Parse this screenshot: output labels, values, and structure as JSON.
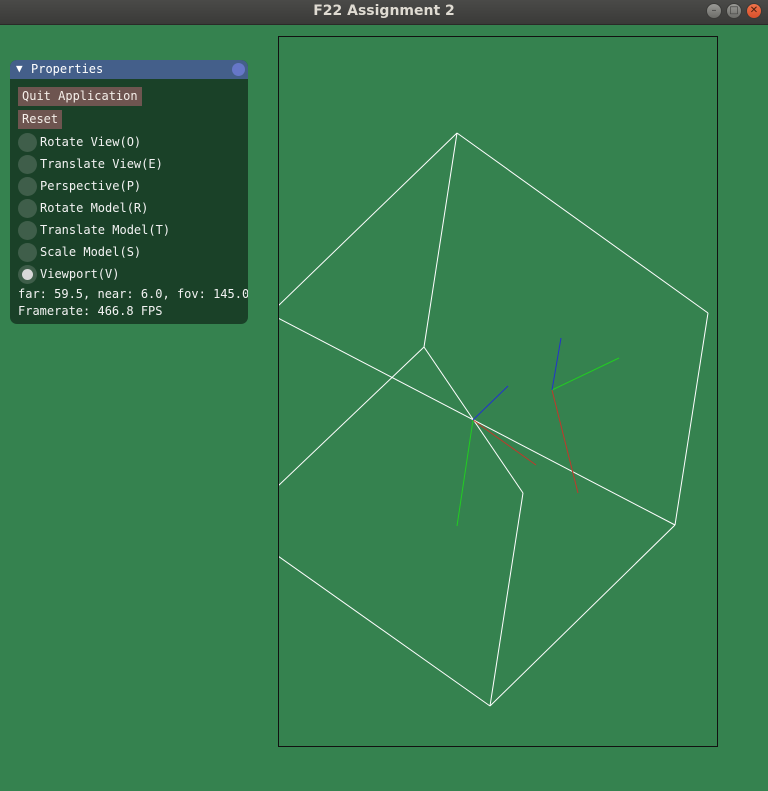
{
  "window": {
    "title": "F22 Assignment 2",
    "buttons": {
      "minimize": "–",
      "maximize": "□",
      "close": "✕"
    }
  },
  "panel": {
    "title": "Properties",
    "buttons": {
      "quit": "Quit Application",
      "reset": "Reset"
    },
    "modes": [
      {
        "label": "Rotate View(O)",
        "selected": false
      },
      {
        "label": "Translate View(E)",
        "selected": false
      },
      {
        "label": "Perspective(P)",
        "selected": false
      },
      {
        "label": "Rotate Model(R)",
        "selected": false
      },
      {
        "label": "Translate Model(T)",
        "selected": false
      },
      {
        "label": "Scale Model(S)",
        "selected": false
      },
      {
        "label": "Viewport(V)",
        "selected": true
      }
    ],
    "info": "far: 59.5, near: 6.0, fov: 145.0",
    "framerate": "Framerate: 466.8 FPS"
  },
  "colors": {
    "background": "#35824f",
    "panel_bg": "#1a4128",
    "header": "#445f8a",
    "axis_x": "#c0392b",
    "axis_y": "#22cc22",
    "axis_z": "#2233cc",
    "wire": "#ffffff"
  }
}
